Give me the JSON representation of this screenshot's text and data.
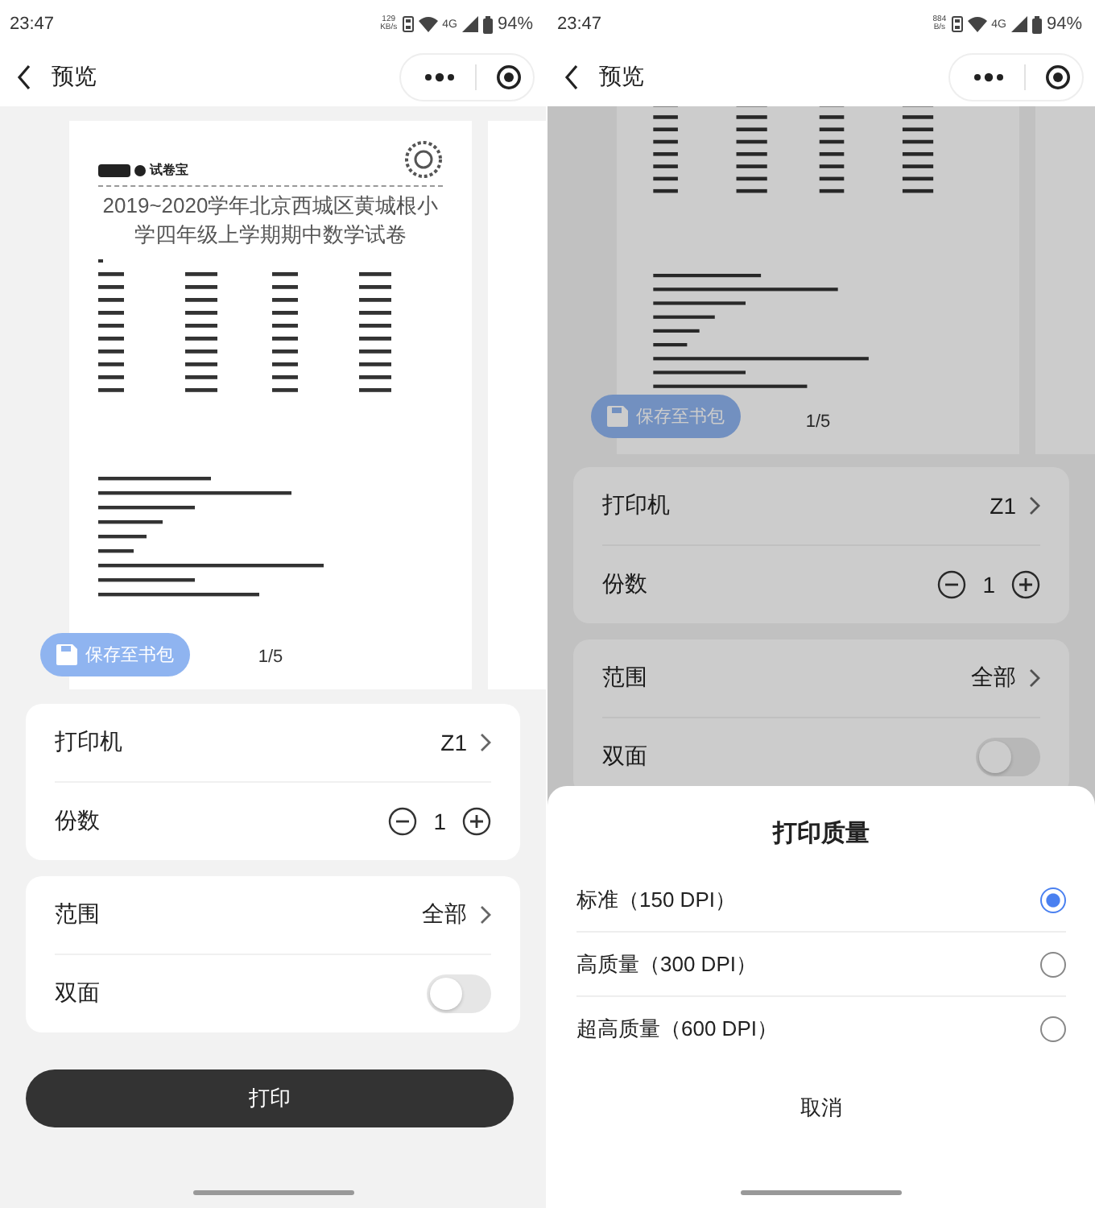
{
  "screens": [
    {
      "status_bar": {
        "time": "23:47",
        "speed_value": "129",
        "speed_unit": "KB/s",
        "network": "4G",
        "battery": "94%"
      },
      "nav": {
        "title": "预览"
      },
      "preview": {
        "logo_text": "试卷宝",
        "title": "2019~2020学年北京西城区黄城根小学四年级上学期期中数学试卷",
        "page_indicator": "1/5",
        "save_button": "保存至书包"
      },
      "settings": [
        {
          "items": [
            {
              "kind": "select",
              "label": "打印机",
              "value": "Z1"
            },
            {
              "kind": "stepper",
              "label": "份数",
              "value": "1"
            }
          ]
        },
        {
          "items": [
            {
              "kind": "select",
              "label": "范围",
              "value": "全部"
            },
            {
              "kind": "toggle",
              "label": "双面",
              "on": false
            }
          ]
        }
      ],
      "print_button": "打印"
    },
    {
      "status_bar": {
        "time": "23:47",
        "speed_value": "884",
        "speed_unit": "B/s",
        "network": "4G",
        "battery": "94%"
      },
      "nav": {
        "title": "预览"
      },
      "preview": {
        "page_indicator": "1/5",
        "save_button": "保存至书包"
      },
      "settings": [
        {
          "items": [
            {
              "kind": "select",
              "label": "打印机",
              "value": "Z1"
            },
            {
              "kind": "stepper",
              "label": "份数",
              "value": "1"
            }
          ]
        },
        {
          "items": [
            {
              "kind": "select",
              "label": "范围",
              "value": "全部"
            },
            {
              "kind": "toggle",
              "label": "双面",
              "on": false
            }
          ]
        }
      ],
      "sheet": {
        "title": "打印质量",
        "options": [
          {
            "label": "标准（150 DPI）",
            "selected": true
          },
          {
            "label": "高质量（300 DPI）",
            "selected": false
          },
          {
            "label": "超高质量（600 DPI）",
            "selected": false
          }
        ],
        "cancel": "取消"
      }
    }
  ]
}
